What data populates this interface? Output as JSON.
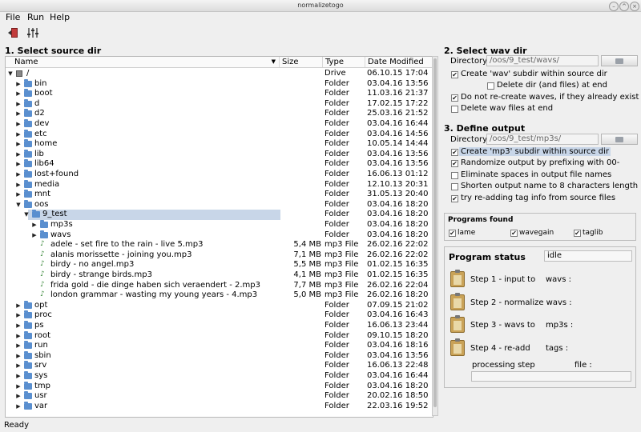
{
  "window": {
    "title": "normalizetogo"
  },
  "menu": {
    "file": "File",
    "run": "Run",
    "help": "Help"
  },
  "toolbar": {
    "exit_icon": "exit-door-icon",
    "settings_icon": "equalizer-settings-icon"
  },
  "section1": {
    "title": "1. Select source dir"
  },
  "tree": {
    "headers": {
      "name": "Name",
      "size": "Size",
      "type": "Type",
      "date": "Date Modified"
    },
    "rows": [
      {
        "level": 0,
        "exp": "▼",
        "icon": "drive",
        "name": "/",
        "size": "",
        "type": "Drive",
        "date": "06.10.15 17:04"
      },
      {
        "level": 1,
        "exp": "▶",
        "icon": "folder",
        "name": "bin",
        "size": "",
        "type": "Folder",
        "date": "03.04.16 13:56"
      },
      {
        "level": 1,
        "exp": "▶",
        "icon": "folder",
        "name": "boot",
        "size": "",
        "type": "Folder",
        "date": "11.03.16 21:37"
      },
      {
        "level": 1,
        "exp": "▶",
        "icon": "folder",
        "name": "d",
        "size": "",
        "type": "Folder",
        "date": "17.02.15 17:22"
      },
      {
        "level": 1,
        "exp": "▶",
        "icon": "folder",
        "name": "d2",
        "size": "",
        "type": "Folder",
        "date": "25.03.16 21:52"
      },
      {
        "level": 1,
        "exp": "▶",
        "icon": "folder",
        "name": "dev",
        "size": "",
        "type": "Folder",
        "date": "03.04.16 16:44"
      },
      {
        "level": 1,
        "exp": "▶",
        "icon": "folder",
        "name": "etc",
        "size": "",
        "type": "Folder",
        "date": "03.04.16 14:56"
      },
      {
        "level": 1,
        "exp": "▶",
        "icon": "folder",
        "name": "home",
        "size": "",
        "type": "Folder",
        "date": "10.05.14 14:44"
      },
      {
        "level": 1,
        "exp": "▶",
        "icon": "folder",
        "name": "lib",
        "size": "",
        "type": "Folder",
        "date": "03.04.16 13:56"
      },
      {
        "level": 1,
        "exp": "▶",
        "icon": "folder",
        "name": "lib64",
        "size": "",
        "type": "Folder",
        "date": "03.04.16 13:56"
      },
      {
        "level": 1,
        "exp": "▶",
        "icon": "folder",
        "name": "lost+found",
        "size": "",
        "type": "Folder",
        "date": "16.06.13 01:12"
      },
      {
        "level": 1,
        "exp": "▶",
        "icon": "folder",
        "name": "media",
        "size": "",
        "type": "Folder",
        "date": "12.10.13 20:31"
      },
      {
        "level": 1,
        "exp": "▶",
        "icon": "folder",
        "name": "mnt",
        "size": "",
        "type": "Folder",
        "date": "31.05.13 20:40"
      },
      {
        "level": 1,
        "exp": "▼",
        "icon": "folder",
        "name": "oos",
        "size": "",
        "type": "Folder",
        "date": "03.04.16 18:20"
      },
      {
        "level": 2,
        "exp": "▼",
        "icon": "folder",
        "name": "9_test",
        "size": "",
        "type": "Folder",
        "date": "03.04.16 18:20",
        "selected": true
      },
      {
        "level": 3,
        "exp": "▶",
        "icon": "folder",
        "name": "mp3s",
        "size": "",
        "type": "Folder",
        "date": "03.04.16 18:20"
      },
      {
        "level": 3,
        "exp": "▶",
        "icon": "folder",
        "name": "wavs",
        "size": "",
        "type": "Folder",
        "date": "03.04.16 18:20"
      },
      {
        "level": 3,
        "exp": "",
        "icon": "file",
        "name": "adele - set fire to the rain - live 5.mp3",
        "size": "5,4 MB",
        "type": "mp3 File",
        "date": "26.02.16 22:02"
      },
      {
        "level": 3,
        "exp": "",
        "icon": "file",
        "name": "alanis morissette - joining you.mp3",
        "size": "7,1 MB",
        "type": "mp3 File",
        "date": "26.02.16 22:02"
      },
      {
        "level": 3,
        "exp": "",
        "icon": "file",
        "name": "birdy - no angel.mp3",
        "size": "5,5 MB",
        "type": "mp3 File",
        "date": "01.02.15 16:35"
      },
      {
        "level": 3,
        "exp": "",
        "icon": "file",
        "name": "birdy - strange birds.mp3",
        "size": "4,1 MB",
        "type": "mp3 File",
        "date": "01.02.15 16:35"
      },
      {
        "level": 3,
        "exp": "",
        "icon": "file",
        "name": "frida gold - die dinge haben sich veraendert - 2.mp3",
        "size": "7,7 MB",
        "type": "mp3 File",
        "date": "26.02.16 22:04"
      },
      {
        "level": 3,
        "exp": "",
        "icon": "file",
        "name": "london grammar - wasting my young years - 4.mp3",
        "size": "5,0 MB",
        "type": "mp3 File",
        "date": "26.02.16 18:20"
      },
      {
        "level": 1,
        "exp": "▶",
        "icon": "folder",
        "name": "opt",
        "size": "",
        "type": "Folder",
        "date": "07.09.15 21:02"
      },
      {
        "level": 1,
        "exp": "▶",
        "icon": "folder",
        "name": "proc",
        "size": "",
        "type": "Folder",
        "date": "03.04.16 16:43"
      },
      {
        "level": 1,
        "exp": "▶",
        "icon": "folder",
        "name": "ps",
        "size": "",
        "type": "Folder",
        "date": "16.06.13 23:44"
      },
      {
        "level": 1,
        "exp": "▶",
        "icon": "folder",
        "name": "root",
        "size": "",
        "type": "Folder",
        "date": "09.10.15 18:20"
      },
      {
        "level": 1,
        "exp": "▶",
        "icon": "folder",
        "name": "run",
        "size": "",
        "type": "Folder",
        "date": "03.04.16 18:16"
      },
      {
        "level": 1,
        "exp": "▶",
        "icon": "folder",
        "name": "sbin",
        "size": "",
        "type": "Folder",
        "date": "03.04.16 13:56"
      },
      {
        "level": 1,
        "exp": "▶",
        "icon": "folder",
        "name": "srv",
        "size": "",
        "type": "Folder",
        "date": "16.06.13 22:48"
      },
      {
        "level": 1,
        "exp": "▶",
        "icon": "folder",
        "name": "sys",
        "size": "",
        "type": "Folder",
        "date": "03.04.16 16:44"
      },
      {
        "level": 1,
        "exp": "▶",
        "icon": "folder",
        "name": "tmp",
        "size": "",
        "type": "Folder",
        "date": "03.04.16 18:20"
      },
      {
        "level": 1,
        "exp": "▶",
        "icon": "folder",
        "name": "usr",
        "size": "",
        "type": "Folder",
        "date": "20.02.16 18:50"
      },
      {
        "level": 1,
        "exp": "▶",
        "icon": "folder",
        "name": "var",
        "size": "",
        "type": "Folder",
        "date": "22.03.16 19:52"
      }
    ]
  },
  "section2": {
    "title": "2. Select wav dir",
    "directory_label": "Directory",
    "directory_value": "/oos/9_test/wavs/",
    "opt_create": "Create 'wav' subdir within source dir",
    "opt_delete_dir": "Delete dir (and files) at end",
    "opt_no_recreate": "Do not re-create waves, if they already exist",
    "opt_delete_wav": "Delete wav files at end"
  },
  "section3": {
    "title": "3. Define output",
    "directory_label": "Directory",
    "directory_value": "/oos/9_test/mp3s/",
    "opt_create": "Create 'mp3' subdir within source dir",
    "opt_randomize": "Randomize output by prefixing with 00-",
    "opt_spaces": "Eliminate spaces in output file names",
    "opt_shorten": "Shorten output name to 8 characters length",
    "opt_tags": "try re-adding tag info from source files"
  },
  "programs": {
    "title": "Programs found",
    "lame": "lame",
    "wavegain": "wavegain",
    "taglib": "taglib"
  },
  "status": {
    "title": "Program status",
    "value": "idle",
    "step1": "Step 1 - input to",
    "step1b": "wavs :",
    "step2": "Step 2 - normalize wavs :",
    "step3": "Step 3 - wavs to",
    "step3b": "mp3s :",
    "step4": "Step 4 - re-add",
    "step4b": "tags :",
    "processing": "processing step",
    "file": "file :",
    "progress": 0
  },
  "statusbar": {
    "text": "Ready"
  }
}
